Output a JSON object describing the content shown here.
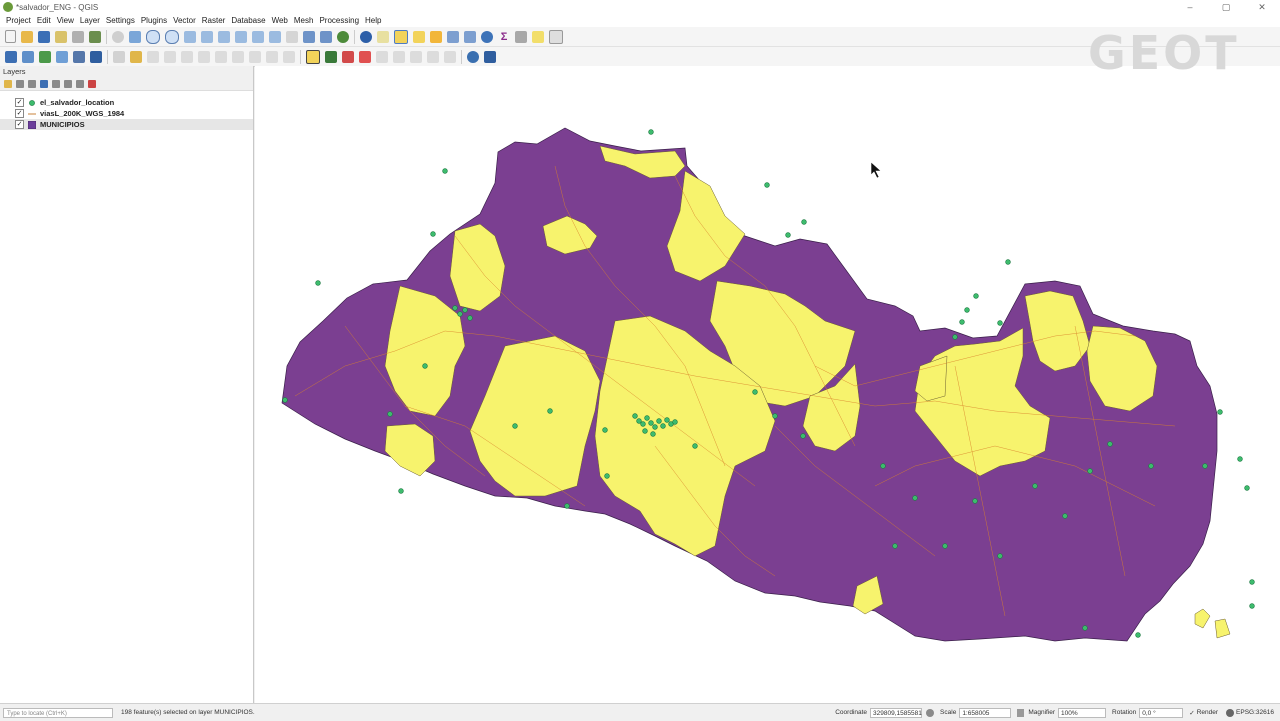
{
  "window": {
    "title": "*salvador_ENG - QGIS"
  },
  "menu": [
    "Project",
    "Edit",
    "View",
    "Layer",
    "Settings",
    "Plugins",
    "Vector",
    "Raster",
    "Database",
    "Web",
    "Mesh",
    "Processing",
    "Help"
  ],
  "layers_panel": {
    "title": "Layers",
    "layers": [
      {
        "name": "el_salvador_location",
        "checked": "✓",
        "symbol": "point",
        "color": "#3dbb6d"
      },
      {
        "name": "viasL_200K_WGS_1984",
        "checked": "✓",
        "symbol": "line",
        "color": "#c8833b"
      },
      {
        "name": "MUNICIPIOS",
        "checked": "✓",
        "symbol": "polygon",
        "color": "#6a3d9a"
      }
    ]
  },
  "map": {
    "fill_primary": "#7b3f91",
    "fill_secondary": "#f7f36d",
    "point_color": "#3dbb6d",
    "road_color": "#d9822b",
    "watermark": "GEOT"
  },
  "status": {
    "locate_placeholder": "Type to locate (Ctrl+K)",
    "message": "198 feature(s) selected on layer MUNICIPIOS.",
    "coordinate_label": "Coordinate",
    "coordinate": "329809,1585581",
    "scale_label": "Scale",
    "scale": "1:658005",
    "magnifier_label": "Magnifier",
    "magnifier": "100%",
    "rotation_label": "Rotation",
    "rotation": "0,0 °",
    "render_label": "Render",
    "crs": "EPSG:32616"
  }
}
